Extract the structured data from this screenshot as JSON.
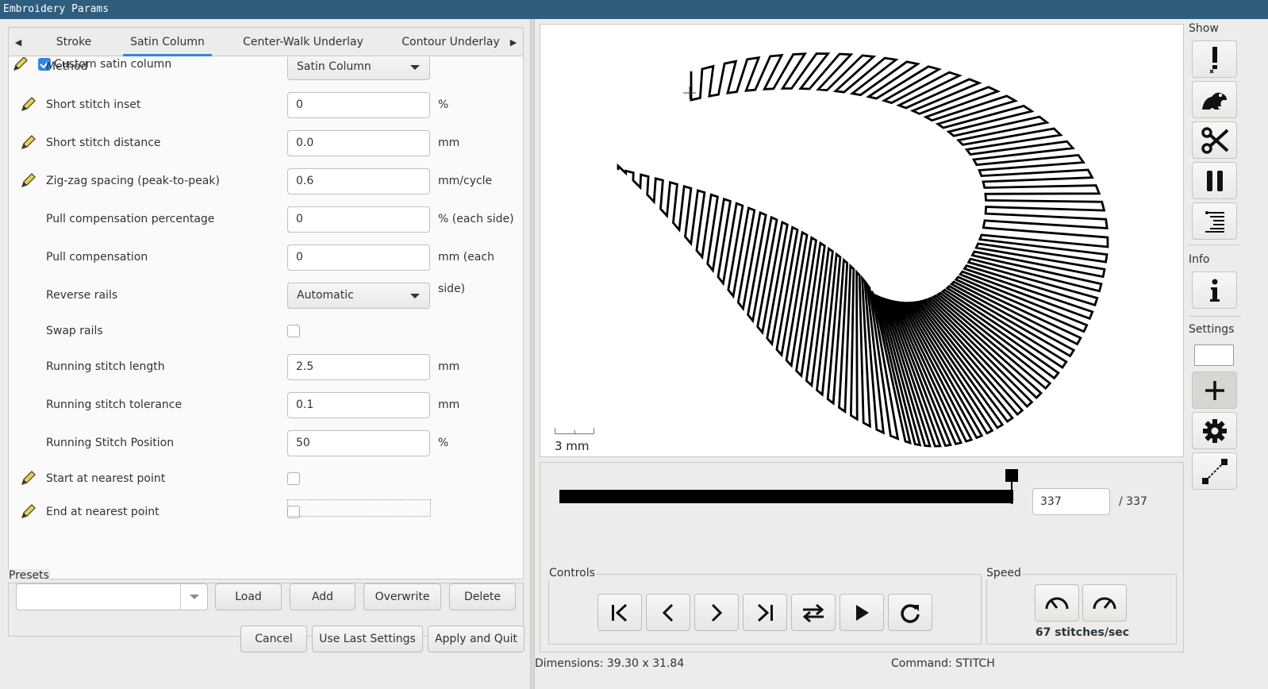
{
  "window": {
    "title": "Embroidery Params"
  },
  "tabs": [
    "Stroke",
    "Satin Column",
    "Center-Walk Underlay",
    "Contour Underlay"
  ],
  "params": {
    "custom_toggle_label": "Custom satin column",
    "rows": [
      {
        "label": "Method",
        "type": "combo",
        "value": "Satin Column",
        "pencil": false
      },
      {
        "label": "Short stitch inset",
        "type": "entry",
        "value": "0",
        "unit": "%",
        "pencil": true
      },
      {
        "label": "Short stitch distance",
        "type": "entry",
        "value": "0.0",
        "unit": "mm",
        "pencil": true
      },
      {
        "label": "Zig-zag spacing (peak-to-peak)",
        "type": "entry",
        "value": "0.6",
        "unit": "mm/cycle",
        "pencil": true
      },
      {
        "label": "Pull compensation percentage",
        "type": "entry",
        "value": "0",
        "unit": "% (each side)",
        "pencil": false
      },
      {
        "label": "Pull compensation",
        "type": "entry",
        "value": "0",
        "unit": "mm (each side)",
        "pencil": false
      },
      {
        "label": "Reverse rails",
        "type": "combo",
        "value": "Automatic",
        "pencil": false
      },
      {
        "label": "Swap rails",
        "type": "check",
        "checked": false,
        "pencil": false
      },
      {
        "label": "Running stitch length",
        "type": "entry",
        "value": "2.5",
        "unit": "mm",
        "pencil": false
      },
      {
        "label": "Running stitch tolerance",
        "type": "entry",
        "value": "0.1",
        "unit": "mm",
        "pencil": false
      },
      {
        "label": "Running Stitch Position",
        "type": "entry",
        "value": "50",
        "unit": "%",
        "pencil": false
      },
      {
        "label": "Start at nearest point",
        "type": "check",
        "checked": false,
        "pencil": true
      },
      {
        "label": "End at nearest point",
        "type": "check",
        "checked": false,
        "pencil": true
      }
    ]
  },
  "presets": {
    "label": "Presets",
    "value": "",
    "buttons": {
      "load": "Load",
      "add": "Add",
      "overwrite": "Overwrite",
      "delete": "Delete"
    }
  },
  "dialog_buttons": {
    "cancel": "Cancel",
    "use_last": "Use Last Settings",
    "apply": "Apply and Quit"
  },
  "preview": {
    "scale_label": "3 mm",
    "stitch_current": "337",
    "stitch_total": "/ 337",
    "slider_fraction": 1.0,
    "controls_label": "Controls",
    "speed_label": "Speed",
    "speed_value": "67 stitches/sec"
  },
  "status": {
    "dimensions": "Dimensions: 39.30 x 31.84",
    "command": "Command: STITCH"
  },
  "sidebar": {
    "show_label": "Show",
    "info_label": "Info",
    "settings_label": "Settings"
  },
  "icons": {
    "show": [
      "error-marker-icon",
      "frog-icon",
      "scissors-icon",
      "pause-icon",
      "needle-point-icon"
    ],
    "info": [
      "info-icon"
    ],
    "settings": [
      "color-swatch",
      "zoom-plus-icon",
      "gear-icon",
      "jump-line-icon"
    ]
  }
}
